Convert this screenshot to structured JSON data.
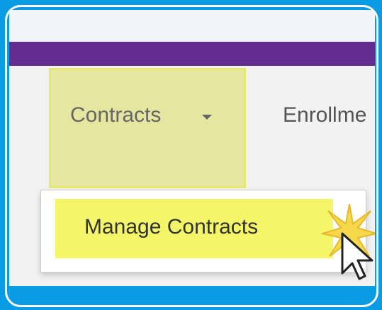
{
  "nav": {
    "items": [
      {
        "label": "Contracts",
        "has_caret": true,
        "state": "highlighted"
      },
      {
        "label": "Enrollme"
      }
    ],
    "dropdown": {
      "items": [
        {
          "label": "Manage Contracts",
          "state": "highlighted"
        }
      ]
    }
  },
  "colors": {
    "outer_background": "#0a9be5",
    "header_bar": "#652c8f",
    "highlight": "#f5f56a"
  },
  "icons": {
    "caret": "chevron-down-icon",
    "cursor": "mouse-pointer-icon",
    "click_burst": "click-burst-icon"
  }
}
